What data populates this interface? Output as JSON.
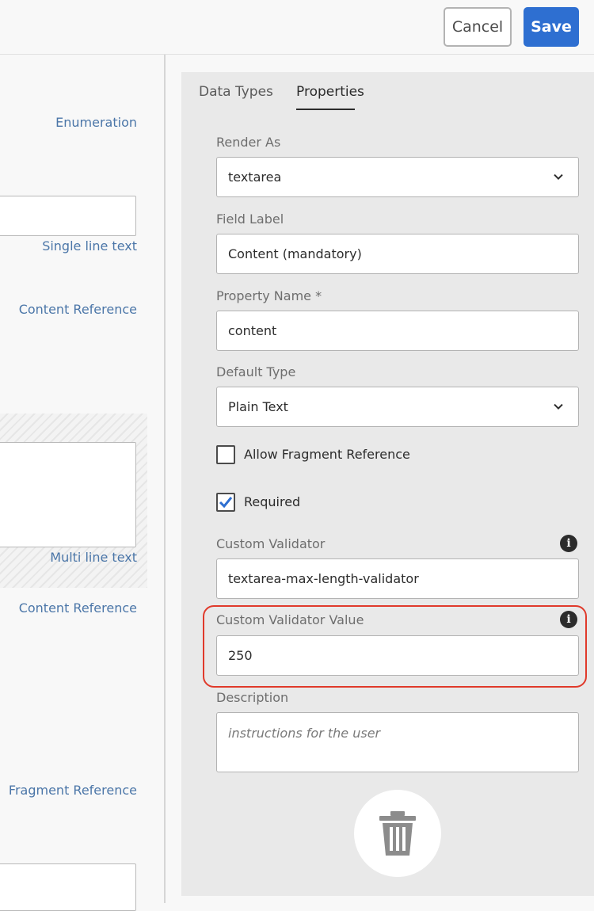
{
  "header": {
    "cancel_label": "Cancel",
    "save_label": "Save"
  },
  "canvas": {
    "items": [
      {
        "label": "Enumeration"
      },
      {
        "label": "Single line text"
      },
      {
        "label": "Content Reference"
      },
      {
        "label": "Multi line text"
      },
      {
        "label": "Content Reference"
      },
      {
        "label": "Fragment Reference"
      }
    ]
  },
  "tabs": [
    {
      "label": "Data Types",
      "active": false
    },
    {
      "label": "Properties",
      "active": true
    }
  ],
  "properties": {
    "render_as": {
      "label": "Render As",
      "value": "textarea"
    },
    "field_label": {
      "label": "Field Label",
      "value": "Content (mandatory)"
    },
    "property_name": {
      "label": "Property Name *",
      "value": "content"
    },
    "default_type": {
      "label": "Default Type",
      "value": "Plain Text"
    },
    "allow_fragment_reference": {
      "label": "Allow Fragment Reference",
      "checked": false
    },
    "required": {
      "label": "Required",
      "checked": true
    },
    "custom_validator": {
      "label": "Custom Validator",
      "value": "textarea-max-length-validator"
    },
    "custom_validator_value": {
      "label": "Custom Validator Value",
      "value": "250"
    },
    "description": {
      "label": "Description",
      "placeholder": "instructions for the user"
    }
  },
  "icons": {
    "info": "info-icon",
    "chevron": "chevron-down-icon",
    "trash": "trash-icon",
    "check": "checkmark-icon"
  },
  "colors": {
    "accent": "#2e6fd1",
    "highlight": "#e03a2b",
    "link_label": "#4b76a8"
  }
}
